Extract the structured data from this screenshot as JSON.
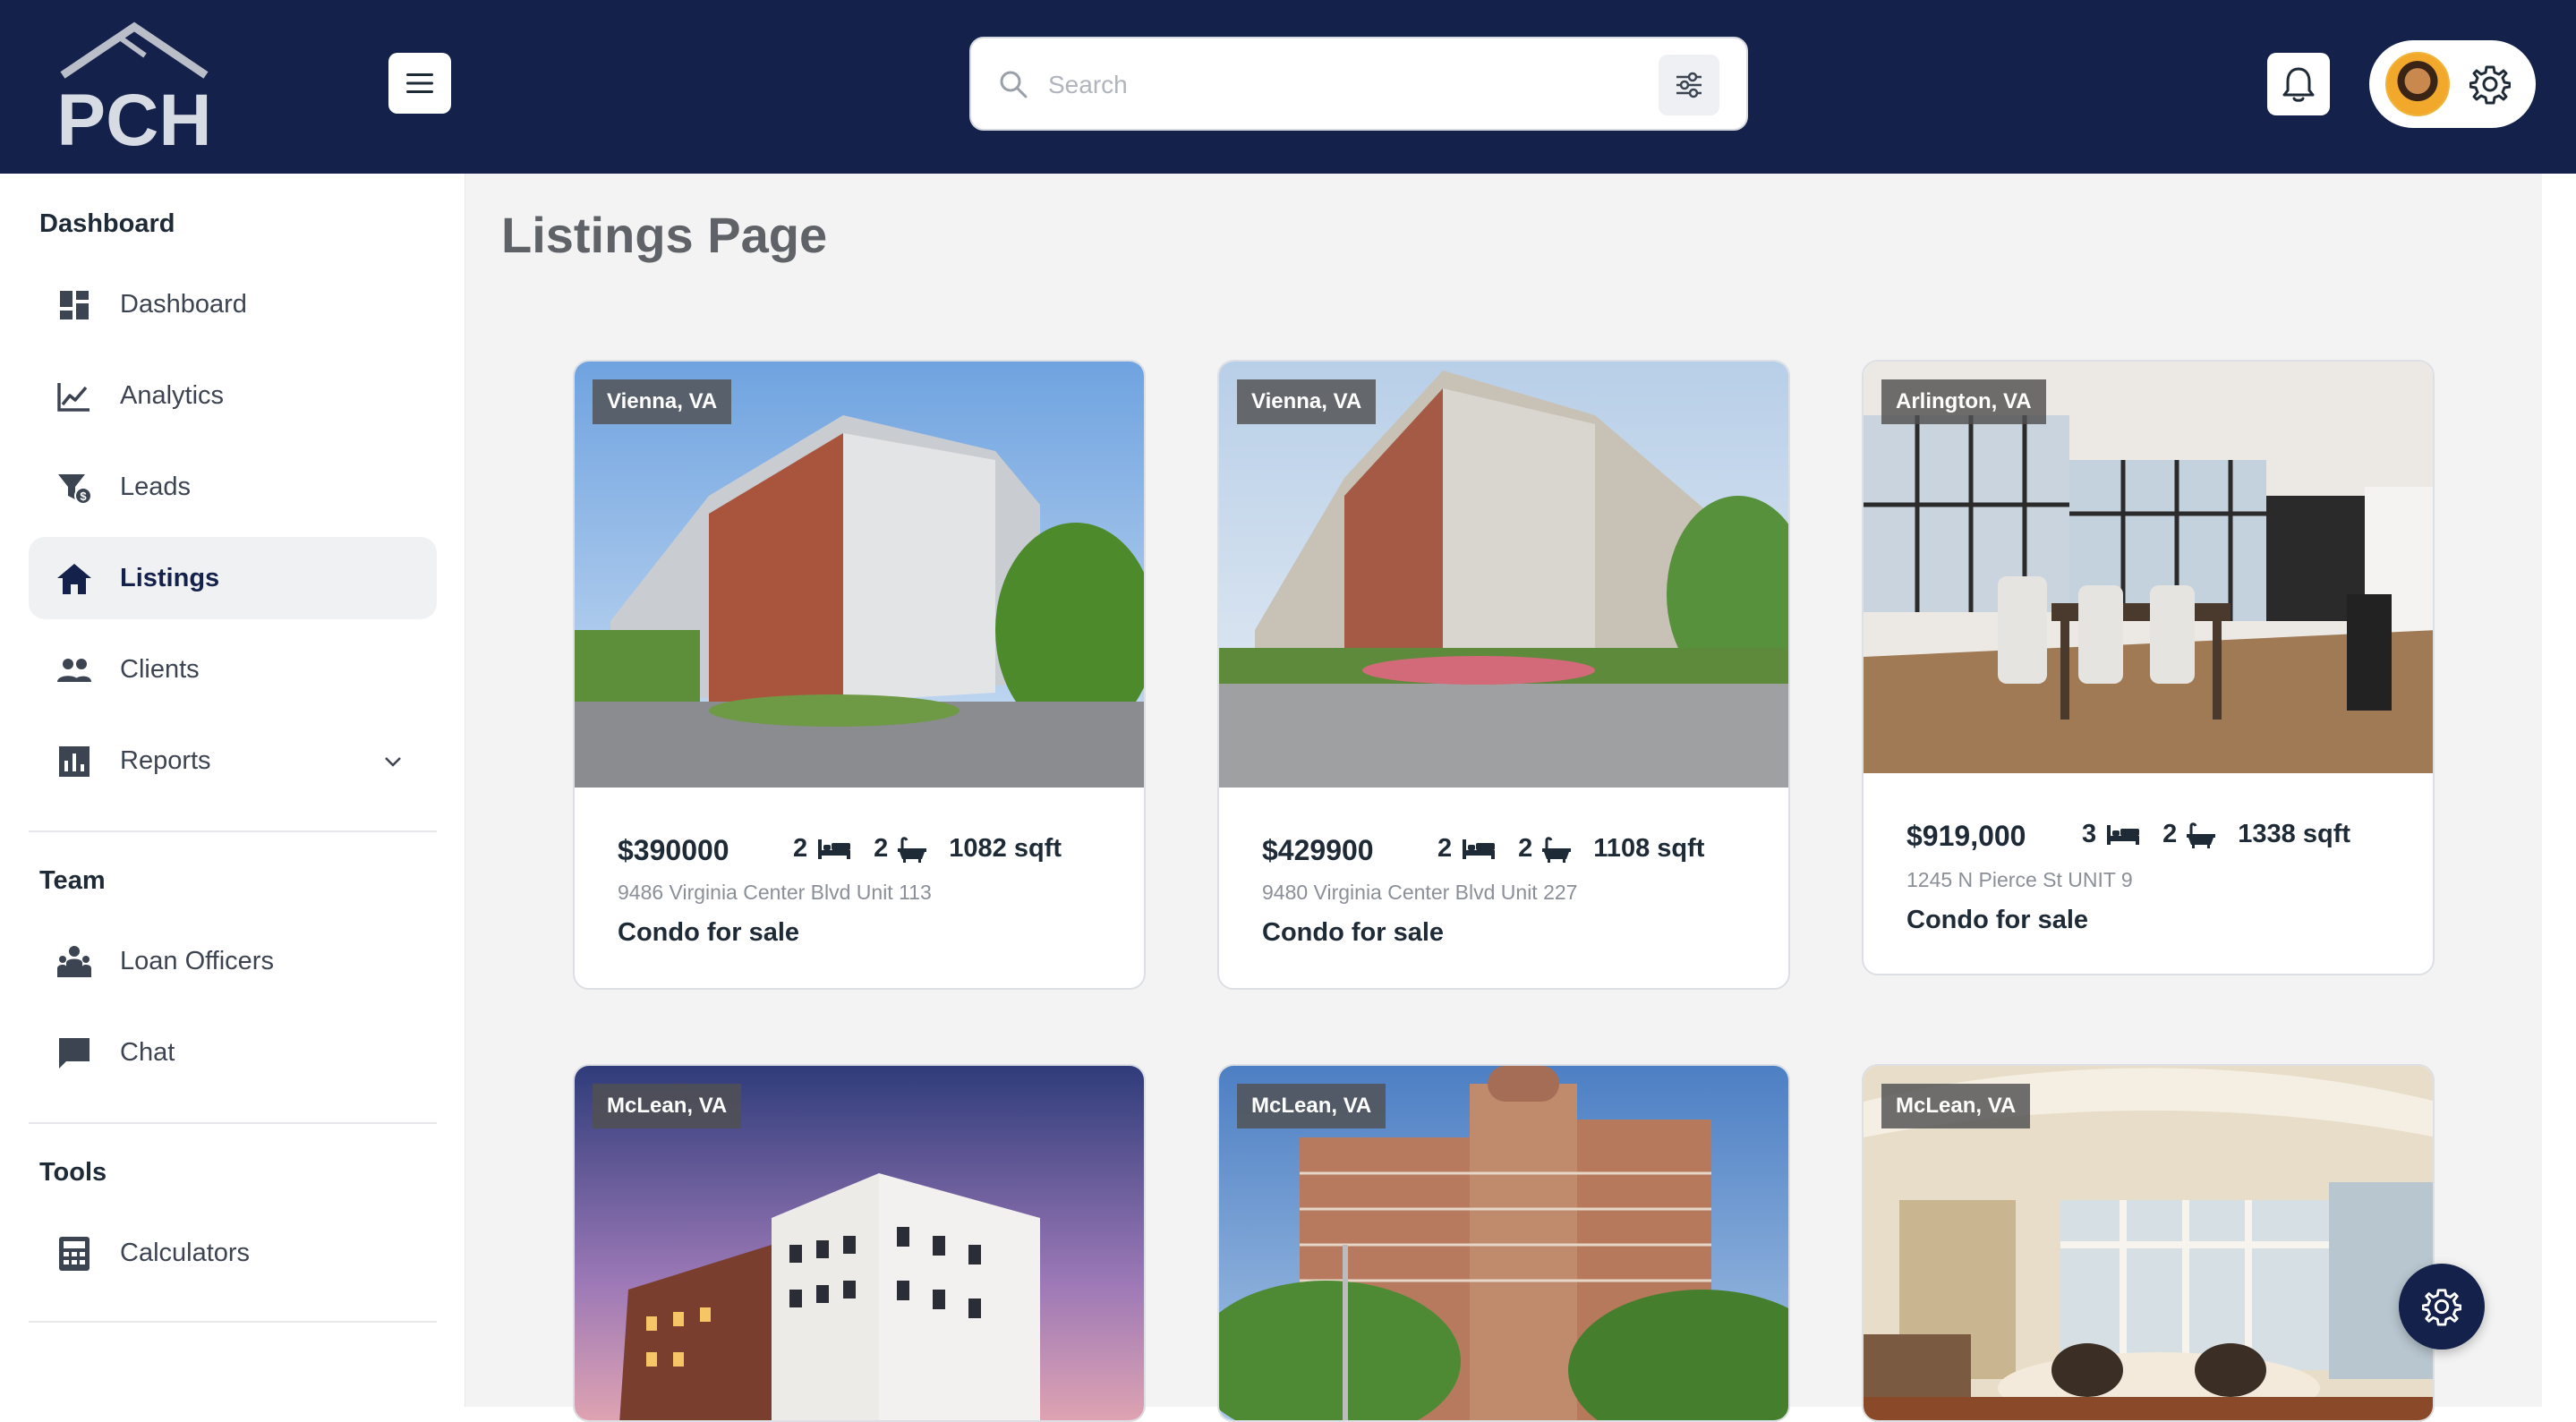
{
  "header": {
    "logo_text": "PCH",
    "search_placeholder": "Search"
  },
  "sidebar": {
    "sections": [
      {
        "title": "Dashboard"
      },
      {
        "title": "Team"
      },
      {
        "title": "Tools"
      }
    ],
    "items": [
      {
        "label": "Dashboard",
        "icon": "dashboard-icon"
      },
      {
        "label": "Analytics",
        "icon": "analytics-icon"
      },
      {
        "label": "Leads",
        "icon": "leads-icon"
      },
      {
        "label": "Listings",
        "icon": "home-icon",
        "active": true
      },
      {
        "label": "Clients",
        "icon": "clients-icon"
      },
      {
        "label": "Reports",
        "icon": "reports-icon"
      },
      {
        "label": "Loan Officers",
        "icon": "loan-officers-icon"
      },
      {
        "label": "Chat",
        "icon": "chat-icon"
      },
      {
        "label": "Calculators",
        "icon": "calculator-icon"
      }
    ]
  },
  "main": {
    "title": "Listings Page",
    "listings": [
      {
        "location": "Vienna, VA",
        "price": "$390000",
        "beds": "2",
        "baths": "2",
        "sqft": "1082 sqft",
        "address": "9486 Virginia Center Blvd Unit 113",
        "type": "Condo for sale"
      },
      {
        "location": "Vienna, VA",
        "price": "$429900",
        "beds": "2",
        "baths": "2",
        "sqft": "1108 sqft",
        "address": "9480 Virginia Center Blvd Unit 227",
        "type": "Condo for sale"
      },
      {
        "location": "Arlington, VA",
        "price": "$919,000",
        "beds": "3",
        "baths": "2",
        "sqft": "1338 sqft",
        "address": "1245 N Pierce St UNIT 9",
        "type": "Condo for sale"
      },
      {
        "location": "McLean, VA"
      },
      {
        "location": "McLean, VA"
      },
      {
        "location": "McLean, VA"
      }
    ]
  },
  "colors": {
    "navy": "#14214a",
    "background": "#f3f3f4"
  }
}
